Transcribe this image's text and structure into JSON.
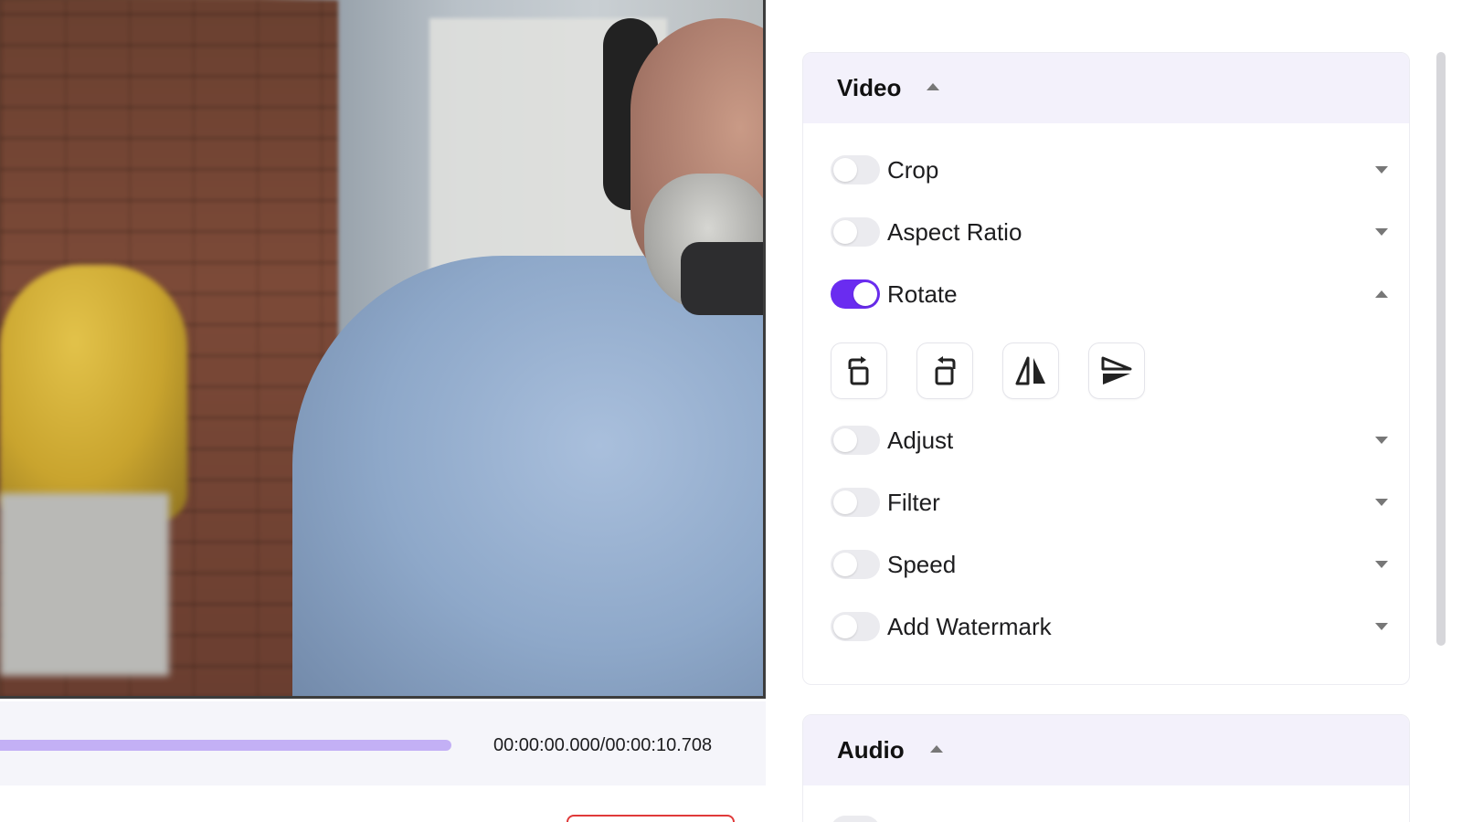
{
  "player": {
    "timecode": "00:00:00.000/00:00:10.708",
    "progress_fraction": 0.59
  },
  "video_panel": {
    "title": "Video",
    "options": [
      {
        "label": "Crop",
        "enabled": false,
        "expanded": false
      },
      {
        "label": "Aspect Ratio",
        "enabled": false,
        "expanded": false
      },
      {
        "label": "Rotate",
        "enabled": true,
        "expanded": true
      },
      {
        "label": "Adjust",
        "enabled": false,
        "expanded": false
      },
      {
        "label": "Filter",
        "enabled": false,
        "expanded": false
      },
      {
        "label": "Speed",
        "enabled": false,
        "expanded": false
      },
      {
        "label": "Add Watermark",
        "enabled": false,
        "expanded": false
      }
    ],
    "rotate_actions": [
      {
        "icon": "rotate-clockwise-icon"
      },
      {
        "icon": "rotate-counterclockwise-icon"
      },
      {
        "icon": "flip-horizontal-icon"
      },
      {
        "icon": "flip-vertical-icon"
      }
    ]
  },
  "audio_panel": {
    "title": "Audio"
  },
  "colors": {
    "accent": "#6a2cf0",
    "progress": "#c3b0f5",
    "header_bg": "#f3f1fb",
    "danger": "#e03a3a"
  }
}
